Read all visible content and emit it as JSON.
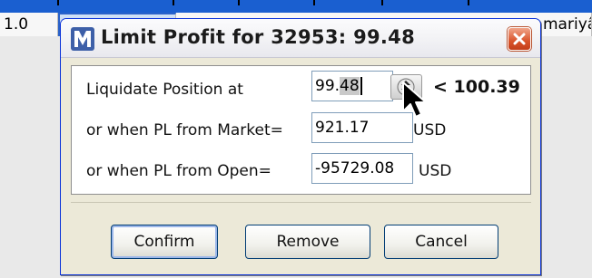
{
  "background": {
    "row_number": "1.0",
    "right_cell_text": "mariyâ"
  },
  "dialog": {
    "title": "Limit Profit for 32953: 99.48",
    "icon": "app-logo-icon",
    "close_icon": "close-icon",
    "rows": [
      {
        "label": "Liquidate Position at",
        "value": "99.48",
        "selected_part": "48",
        "unit": "",
        "limit": "< 100.39"
      },
      {
        "label": "or when PL from Market=",
        "value": "921.17",
        "unit": "USD"
      },
      {
        "label": "or when PL from Open=",
        "value": "-95729.08",
        "unit": "USD"
      }
    ],
    "buttons": {
      "confirm": "Confirm",
      "remove": "Remove",
      "cancel": "Cancel"
    }
  },
  "colors": {
    "title_bar_border": "#0831d9",
    "dialog_face": "#ece9d8",
    "close_button": "#d9542b",
    "field_border": "#7f9db9"
  }
}
